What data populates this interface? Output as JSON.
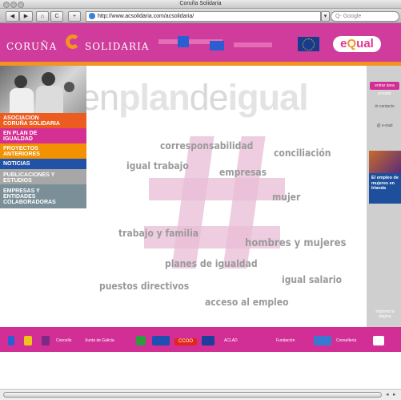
{
  "window": {
    "title": "Coruña Solidaria"
  },
  "toolbar": {
    "back": "◀",
    "forward": "▶",
    "home": "⌂",
    "reload": "C",
    "add": "+",
    "url": "http://www.acsolidaria.com/acsolidaria/",
    "search_placeholder": "Q- Google"
  },
  "header": {
    "brand_left": "CORUÑA",
    "brand_right": "SOLIDARIA",
    "equal_logo_e": "e",
    "equal_logo_q": "Q",
    "equal_logo_rest": "ual",
    "colors": {
      "header_bg": "#cf3c9b",
      "accent_orange": "#f39321",
      "accent_blue": "#2b5fd1"
    }
  },
  "nav": {
    "items": [
      {
        "line1": "ASOCIACION",
        "line2": "CORUÑA SOLIDARIA",
        "line3": "",
        "bg": "#ec5b1f"
      },
      {
        "line1": "EN PLAN DE",
        "line2": "IGUALDAD",
        "line3": "",
        "bg": "#d62f93"
      },
      {
        "line1": "PROYECTOS",
        "line2": "ANTERIORES",
        "line3": "",
        "bg": "#f29200"
      },
      {
        "line1": "NOTICIAS",
        "line2": "",
        "line3": "",
        "bg": "#2252a8"
      },
      {
        "line1": "PUBLICACIONES Y",
        "line2": "ESTUDIOS",
        "line3": "",
        "bg": "#a7a7a7"
      },
      {
        "line1": "EMPRESAS Y",
        "line2": "ENTIDADES",
        "line3": "COLABORADORAS",
        "bg": "#7a8f98"
      }
    ]
  },
  "main": {
    "headline": {
      "p1": "en",
      "p2": "plan",
      "p3": "de",
      "p4": "igual"
    },
    "keywords": [
      "corresponsabilidad",
      "conciliación",
      "igual trabajo",
      "empresas",
      "mujer",
      "trabajo y familia",
      "hombres y mujeres",
      "planes de igualdad",
      "igual salario",
      "puestos directivos",
      "acceso al empleo"
    ]
  },
  "right": {
    "btn1": "entrar área privada",
    "btn2": "contacto",
    "btn3": "e-mail",
    "card": "El empleo de mujeres en Irlanda",
    "bottom": "Imprimir la página"
  },
  "footer": {
    "sponsor_texts": [
      "Concello",
      "Xunta de Galicia",
      "CCOO",
      "ACLAD",
      "Fundación",
      "Consellería"
    ]
  }
}
